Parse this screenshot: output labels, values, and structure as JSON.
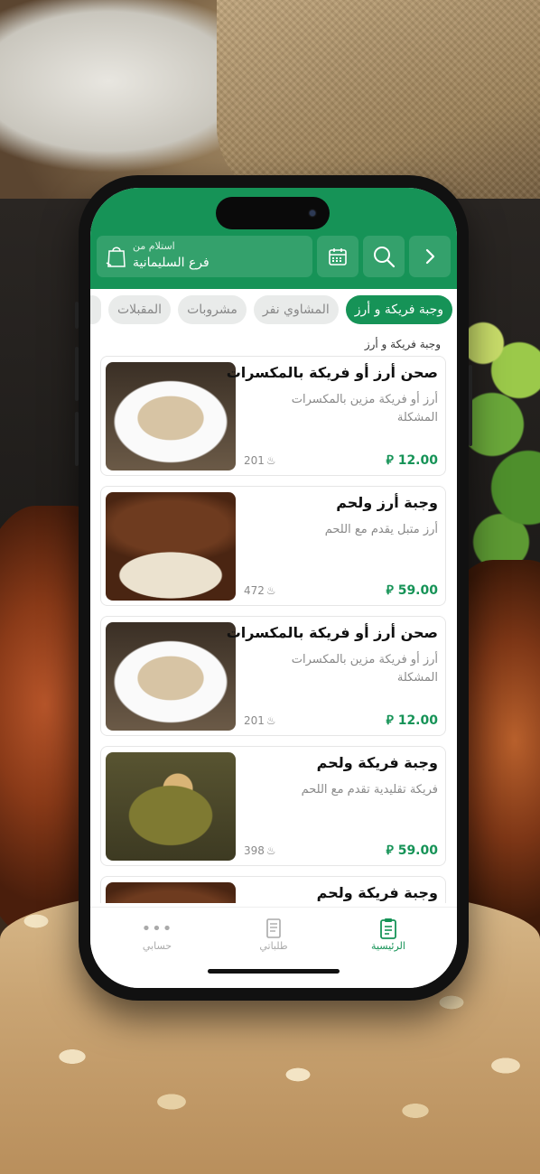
{
  "header": {
    "pickup_label": "استلام من",
    "branch_name": "فرع السليمانية"
  },
  "icons": {
    "bag": "shopping-bag-icon",
    "calendar": "calendar-icon",
    "search": "search-icon",
    "forward": "chevron-right-icon"
  },
  "tabs": [
    {
      "label": "وجبة فريكة و أرز",
      "active": true
    },
    {
      "label": "المشاوي نفر",
      "active": false
    },
    {
      "label": "مشروبات",
      "active": false
    },
    {
      "label": "المقبلات",
      "active": false
    }
  ],
  "section_title": "وجبة فريكة و أرز",
  "items": [
    {
      "name": "صحن أرز أو فريكة بالمكسرات",
      "description": "أرز أو فريكة مزين بالمكسرات المشكلة",
      "price": "12.00",
      "calories": "201"
    },
    {
      "name": "وجبة أرز ولحم",
      "description": "أرز متبل يقدم مع اللحم",
      "price": "59.00",
      "calories": "472"
    },
    {
      "name": "صحن أرز أو فريكة بالمكسرات",
      "description": "أرز أو فريكة مزين بالمكسرات المشكلة",
      "price": "12.00",
      "calories": "201"
    },
    {
      "name": "وجبة فريكة ولحم",
      "description": "فريكة تقليدية تقدم مع اللحم",
      "price": "59.00",
      "calories": "398"
    },
    {
      "name": "وجبة فريكة ولحم",
      "description": "",
      "price": "",
      "calories": ""
    }
  ],
  "nav": {
    "home": "الرئيسية",
    "orders": "طلباتي",
    "account": "حسابي"
  },
  "colors": {
    "brand_green": "#169357",
    "muted_text": "#8a8a8a"
  }
}
